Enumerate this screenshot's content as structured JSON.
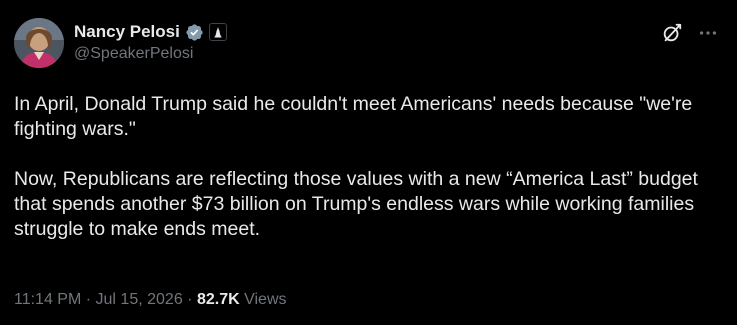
{
  "author": {
    "display_name": "Nancy Pelosi",
    "handle": "@SpeakerPelosi",
    "avatar_icon": "profile-photo",
    "verified_icon": "verified-badge-gray",
    "affiliation_icon": "us-capitol-badge"
  },
  "actions": {
    "grok_icon": "grok-icon",
    "more_icon": "more-options-icon"
  },
  "tweet": {
    "paragraphs": [
      "In April, Donald Trump said he couldn't meet Americans' needs because \"we're fighting wars.\"",
      "Now, Republicans are reflecting those values with a new “America Last” budget that spends another $73 billion on Trump's endless wars while working families struggle to make ends meet."
    ]
  },
  "meta": {
    "time": "11:14 PM",
    "separator": "·",
    "date": "Jul 15, 2026",
    "views_count": "82.7K",
    "views_label": "Views"
  },
  "colors": {
    "background": "#000000",
    "primary_text": "#e7e9ea",
    "secondary_text": "#71767b",
    "verified_badge": "#829aab"
  }
}
